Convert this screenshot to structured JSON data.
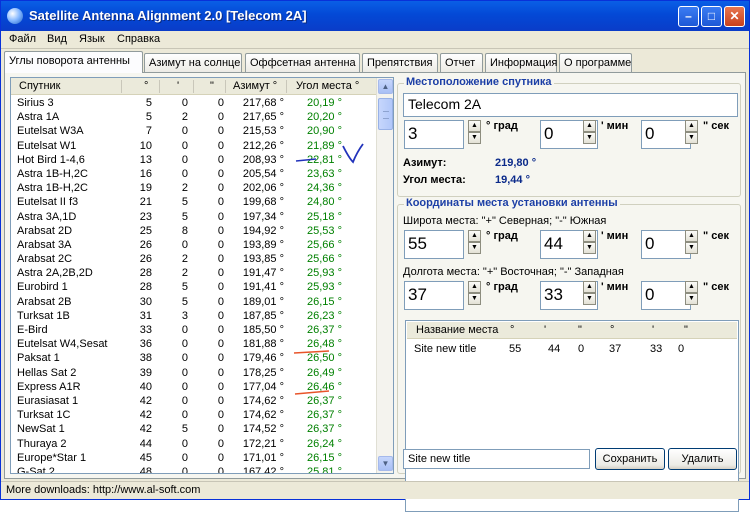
{
  "window": {
    "title": "Satellite Antenna Alignment 2.0 [Telecom 2A]",
    "minimize": "–",
    "maximize": "□",
    "close": "✕"
  },
  "menu": [
    "Файл",
    "Вид",
    "Язык",
    "Справка"
  ],
  "tabs": [
    "Углы поворота антенны",
    "Азимут на солнце",
    "Оффсетная антенна",
    "Препятствия",
    "Отчет",
    "Информация",
    "О программе"
  ],
  "list": {
    "columns": {
      "name": "Спутник",
      "deg": "°",
      "min": "'",
      "sec": "\"",
      "azimuth": "Азимут °",
      "elevation": "Угол места °"
    },
    "rows": [
      [
        "Sirius 3",
        "5",
        "0",
        "0",
        "217,68 °",
        "20,19 °"
      ],
      [
        "Astra 1A",
        "5",
        "2",
        "0",
        "217,65 °",
        "20,20 °"
      ],
      [
        "Eutelsat W3A",
        "7",
        "0",
        "0",
        "215,53 °",
        "20,90 °"
      ],
      [
        "Eutelsat W1",
        "10",
        "0",
        "0",
        "212,26 °",
        "21,89 °"
      ],
      [
        "Hot Bird 1-4,6",
        "13",
        "0",
        "0",
        "208,93 °",
        "22,81 °"
      ],
      [
        "Astra 1B-H,2C",
        "16",
        "0",
        "0",
        "205,54 °",
        "23,63 °"
      ],
      [
        "Astra 1B-H,2C",
        "19",
        "2",
        "0",
        "202,06 °",
        "24,36 °"
      ],
      [
        "Eutelsat II f3",
        "21",
        "5",
        "0",
        "199,68 °",
        "24,80 °"
      ],
      [
        "Astra 3A,1D",
        "23",
        "5",
        "0",
        "197,34 °",
        "25,18 °"
      ],
      [
        "Arabsat 2D",
        "25",
        "8",
        "0",
        "194,92 °",
        "25,53 °"
      ],
      [
        "Arabsat 3A",
        "26",
        "0",
        "0",
        "193,89 °",
        "25,66 °"
      ],
      [
        "Arabsat 2C",
        "26",
        "2",
        "0",
        "193,85 °",
        "25,66 °"
      ],
      [
        "Astra 2A,2B,2D",
        "28",
        "2",
        "0",
        "191,47 °",
        "25,93 °"
      ],
      [
        "Eurobird 1",
        "28",
        "5",
        "0",
        "191,41 °",
        "25,93 °"
      ],
      [
        "Arabsat 2B",
        "30",
        "5",
        "0",
        "189,01 °",
        "26,15 °"
      ],
      [
        "Turksat 1B",
        "31",
        "3",
        "0",
        "187,85 °",
        "26,23 °"
      ],
      [
        "E-Bird",
        "33",
        "0",
        "0",
        "185,50 °",
        "26,37 °"
      ],
      [
        "Eutelsat W4,Sesat",
        "36",
        "0",
        "0",
        "181,88 °",
        "26,48 °"
      ],
      [
        "Paksat 1",
        "38",
        "0",
        "0",
        "179,46 °",
        "26,50 °"
      ],
      [
        "Hellas Sat 2",
        "39",
        "0",
        "0",
        "178,25 °",
        "26,49 °"
      ],
      [
        "Express A1R",
        "40",
        "0",
        "0",
        "177,04 °",
        "26,46 °"
      ],
      [
        "Eurasiasat 1",
        "42",
        "0",
        "0",
        "174,62 °",
        "26,37 °"
      ],
      [
        "Turksat 1C",
        "42",
        "0",
        "0",
        "174,62 °",
        "26,37 °"
      ],
      [
        "NewSat 1",
        "42",
        "5",
        "0",
        "174,52 °",
        "26,37 °"
      ],
      [
        "Thuraya 2",
        "44",
        "0",
        "0",
        "172,21 °",
        "26,24 °"
      ],
      [
        "Europe*Star 1",
        "45",
        "0",
        "0",
        "171,01 °",
        "26,15 °"
      ],
      [
        "G-Sat 2",
        "48",
        "0",
        "0",
        "167,42 °",
        "25,81 °"
      ]
    ]
  },
  "satellite": {
    "group_title": "Местоположение спутника",
    "name": "Telecom 2A",
    "deg": "3",
    "min": "0",
    "sec": "0",
    "unit_deg": "° град",
    "unit_min": "' мин",
    "unit_sec": "\" сек",
    "azimuth_label": "Азимут:",
    "azimuth_value": "219,80 °",
    "elevation_label": "Угол места:",
    "elevation_value": "19,44 °"
  },
  "site": {
    "group_title": "Координаты места установки антенны",
    "lat_label": "Широта места:  \"+\" Северная; \"-\" Южная",
    "lat_deg": "55",
    "lat_min": "44",
    "lat_sec": "0",
    "lon_label": "Долгота места:  \"+\" Восточная; \"-\" Западная",
    "lon_deg": "37",
    "lon_min": "33",
    "lon_sec": "0",
    "unit_deg": "° град",
    "unit_min": "' мин",
    "unit_sec": "\" сек"
  },
  "sites_table": {
    "columns": [
      "Название места",
      "°",
      "'",
      "\"",
      "°",
      "'",
      "\""
    ],
    "row": [
      "Site new title",
      "55",
      "44",
      "0",
      "37",
      "33",
      "0"
    ]
  },
  "site_name_input": "Site new title",
  "buttons": {
    "save": "Сохранить",
    "delete": "Удалить"
  },
  "status": "More downloads: http://www.al-soft.com",
  "icons": {
    "spin_up": "▲",
    "spin_down": "▼",
    "scroll_up": "▲",
    "scroll_down": "▼"
  }
}
